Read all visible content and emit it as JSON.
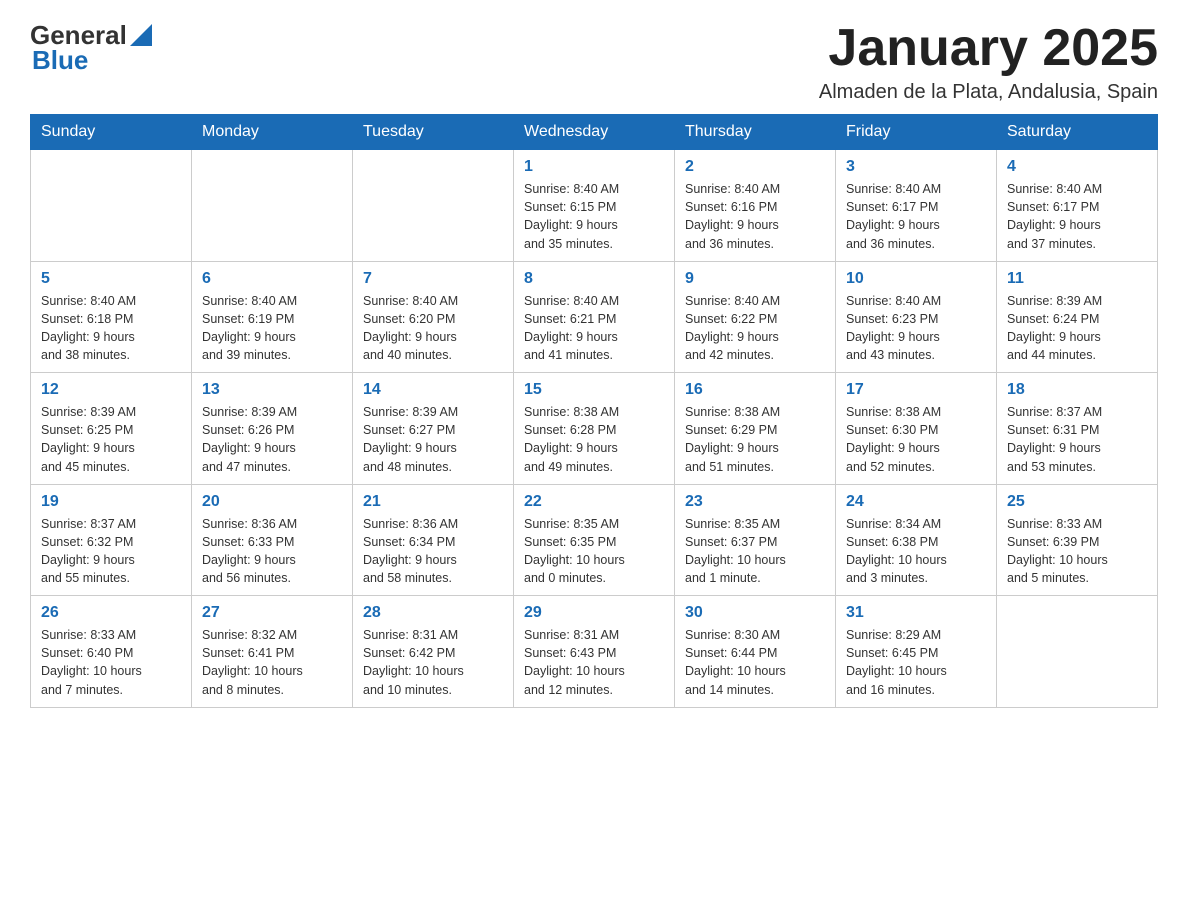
{
  "logo": {
    "text_general": "General",
    "text_blue": "Blue",
    "aria": "GeneralBlue logo"
  },
  "header": {
    "title": "January 2025",
    "subtitle": "Almaden de la Plata, Andalusia, Spain"
  },
  "weekdays": [
    "Sunday",
    "Monday",
    "Tuesday",
    "Wednesday",
    "Thursday",
    "Friday",
    "Saturday"
  ],
  "weeks": [
    [
      {
        "day": "",
        "info": ""
      },
      {
        "day": "",
        "info": ""
      },
      {
        "day": "",
        "info": ""
      },
      {
        "day": "1",
        "info": "Sunrise: 8:40 AM\nSunset: 6:15 PM\nDaylight: 9 hours\nand 35 minutes."
      },
      {
        "day": "2",
        "info": "Sunrise: 8:40 AM\nSunset: 6:16 PM\nDaylight: 9 hours\nand 36 minutes."
      },
      {
        "day": "3",
        "info": "Sunrise: 8:40 AM\nSunset: 6:17 PM\nDaylight: 9 hours\nand 36 minutes."
      },
      {
        "day": "4",
        "info": "Sunrise: 8:40 AM\nSunset: 6:17 PM\nDaylight: 9 hours\nand 37 minutes."
      }
    ],
    [
      {
        "day": "5",
        "info": "Sunrise: 8:40 AM\nSunset: 6:18 PM\nDaylight: 9 hours\nand 38 minutes."
      },
      {
        "day": "6",
        "info": "Sunrise: 8:40 AM\nSunset: 6:19 PM\nDaylight: 9 hours\nand 39 minutes."
      },
      {
        "day": "7",
        "info": "Sunrise: 8:40 AM\nSunset: 6:20 PM\nDaylight: 9 hours\nand 40 minutes."
      },
      {
        "day": "8",
        "info": "Sunrise: 8:40 AM\nSunset: 6:21 PM\nDaylight: 9 hours\nand 41 minutes."
      },
      {
        "day": "9",
        "info": "Sunrise: 8:40 AM\nSunset: 6:22 PM\nDaylight: 9 hours\nand 42 minutes."
      },
      {
        "day": "10",
        "info": "Sunrise: 8:40 AM\nSunset: 6:23 PM\nDaylight: 9 hours\nand 43 minutes."
      },
      {
        "day": "11",
        "info": "Sunrise: 8:39 AM\nSunset: 6:24 PM\nDaylight: 9 hours\nand 44 minutes."
      }
    ],
    [
      {
        "day": "12",
        "info": "Sunrise: 8:39 AM\nSunset: 6:25 PM\nDaylight: 9 hours\nand 45 minutes."
      },
      {
        "day": "13",
        "info": "Sunrise: 8:39 AM\nSunset: 6:26 PM\nDaylight: 9 hours\nand 47 minutes."
      },
      {
        "day": "14",
        "info": "Sunrise: 8:39 AM\nSunset: 6:27 PM\nDaylight: 9 hours\nand 48 minutes."
      },
      {
        "day": "15",
        "info": "Sunrise: 8:38 AM\nSunset: 6:28 PM\nDaylight: 9 hours\nand 49 minutes."
      },
      {
        "day": "16",
        "info": "Sunrise: 8:38 AM\nSunset: 6:29 PM\nDaylight: 9 hours\nand 51 minutes."
      },
      {
        "day": "17",
        "info": "Sunrise: 8:38 AM\nSunset: 6:30 PM\nDaylight: 9 hours\nand 52 minutes."
      },
      {
        "day": "18",
        "info": "Sunrise: 8:37 AM\nSunset: 6:31 PM\nDaylight: 9 hours\nand 53 minutes."
      }
    ],
    [
      {
        "day": "19",
        "info": "Sunrise: 8:37 AM\nSunset: 6:32 PM\nDaylight: 9 hours\nand 55 minutes."
      },
      {
        "day": "20",
        "info": "Sunrise: 8:36 AM\nSunset: 6:33 PM\nDaylight: 9 hours\nand 56 minutes."
      },
      {
        "day": "21",
        "info": "Sunrise: 8:36 AM\nSunset: 6:34 PM\nDaylight: 9 hours\nand 58 minutes."
      },
      {
        "day": "22",
        "info": "Sunrise: 8:35 AM\nSunset: 6:35 PM\nDaylight: 10 hours\nand 0 minutes."
      },
      {
        "day": "23",
        "info": "Sunrise: 8:35 AM\nSunset: 6:37 PM\nDaylight: 10 hours\nand 1 minute."
      },
      {
        "day": "24",
        "info": "Sunrise: 8:34 AM\nSunset: 6:38 PM\nDaylight: 10 hours\nand 3 minutes."
      },
      {
        "day": "25",
        "info": "Sunrise: 8:33 AM\nSunset: 6:39 PM\nDaylight: 10 hours\nand 5 minutes."
      }
    ],
    [
      {
        "day": "26",
        "info": "Sunrise: 8:33 AM\nSunset: 6:40 PM\nDaylight: 10 hours\nand 7 minutes."
      },
      {
        "day": "27",
        "info": "Sunrise: 8:32 AM\nSunset: 6:41 PM\nDaylight: 10 hours\nand 8 minutes."
      },
      {
        "day": "28",
        "info": "Sunrise: 8:31 AM\nSunset: 6:42 PM\nDaylight: 10 hours\nand 10 minutes."
      },
      {
        "day": "29",
        "info": "Sunrise: 8:31 AM\nSunset: 6:43 PM\nDaylight: 10 hours\nand 12 minutes."
      },
      {
        "day": "30",
        "info": "Sunrise: 8:30 AM\nSunset: 6:44 PM\nDaylight: 10 hours\nand 14 minutes."
      },
      {
        "day": "31",
        "info": "Sunrise: 8:29 AM\nSunset: 6:45 PM\nDaylight: 10 hours\nand 16 minutes."
      },
      {
        "day": "",
        "info": ""
      }
    ]
  ]
}
